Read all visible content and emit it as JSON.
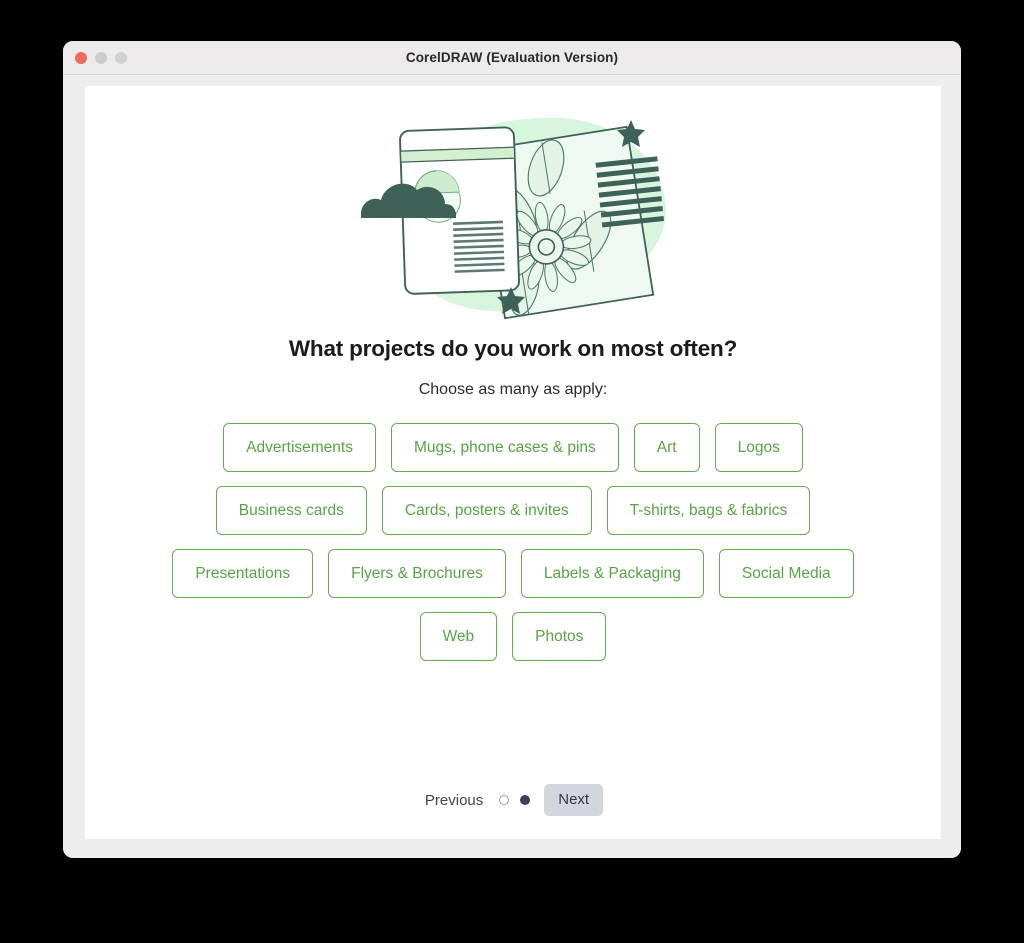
{
  "window": {
    "title": "CorelDRAW (Evaluation Version)",
    "traffic_lights": [
      {
        "name": "close",
        "color": "#ec6a5e"
      },
      {
        "name": "minimize",
        "color": "#cccccc"
      },
      {
        "name": "zoom",
        "color": "#d2d2d2"
      }
    ]
  },
  "main": {
    "heading": "What projects do you work on most often?",
    "subheading": "Choose as many as apply:",
    "option_rows": [
      [
        "Advertisements",
        "Mugs, phone cases & pins",
        "Art",
        "Logos"
      ],
      [
        "Business cards",
        "Cards, posters & invites",
        "T-shirts, bags & fabrics"
      ],
      [
        "Presentations",
        "Flyers & Brochures",
        "Labels & Packaging",
        "Social Media"
      ],
      [
        "Web",
        "Photos"
      ]
    ]
  },
  "footer": {
    "previous_label": "Previous",
    "next_label": "Next",
    "page_dots": [
      {
        "state": "inactive"
      },
      {
        "state": "active"
      }
    ]
  },
  "theme": {
    "accent_green": "#66ad4f",
    "text_green": "#58a444",
    "illustration_dark": "#3e6158",
    "illustration_blob": "#d6f5dd",
    "illustration_light_green": "#cdeccf",
    "button_gray": "#d3d7dd"
  }
}
